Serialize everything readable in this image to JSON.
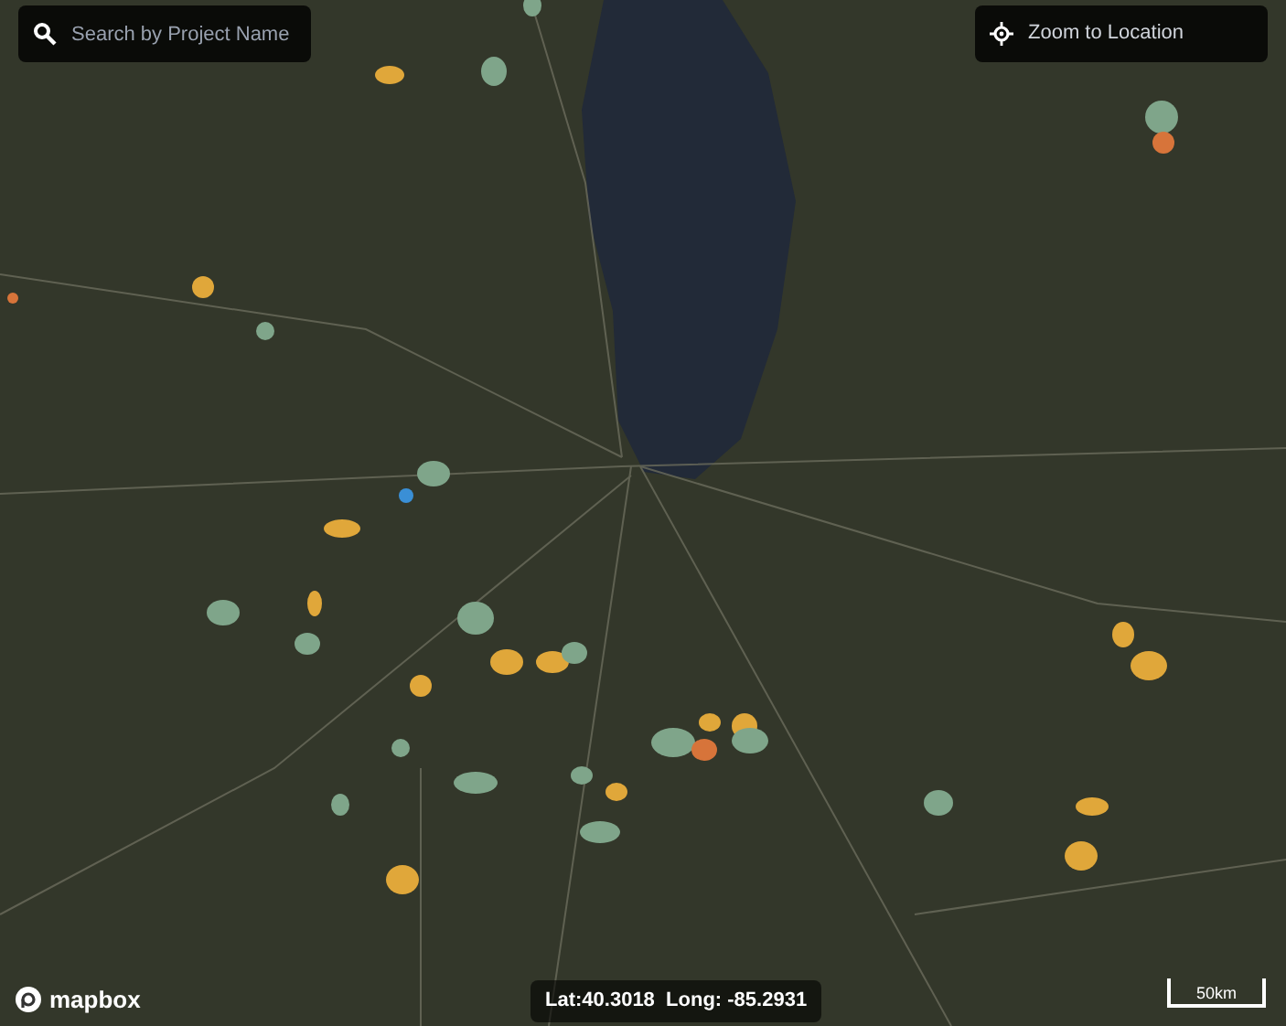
{
  "search": {
    "placeholder": "Search by Project Name"
  },
  "zoom_button": {
    "label": "Zoom to Location"
  },
  "attribution": {
    "logo_text": "mapbox"
  },
  "coordinates": "Lat:40.3018  Long: -85.2931",
  "scale": "50km"
}
